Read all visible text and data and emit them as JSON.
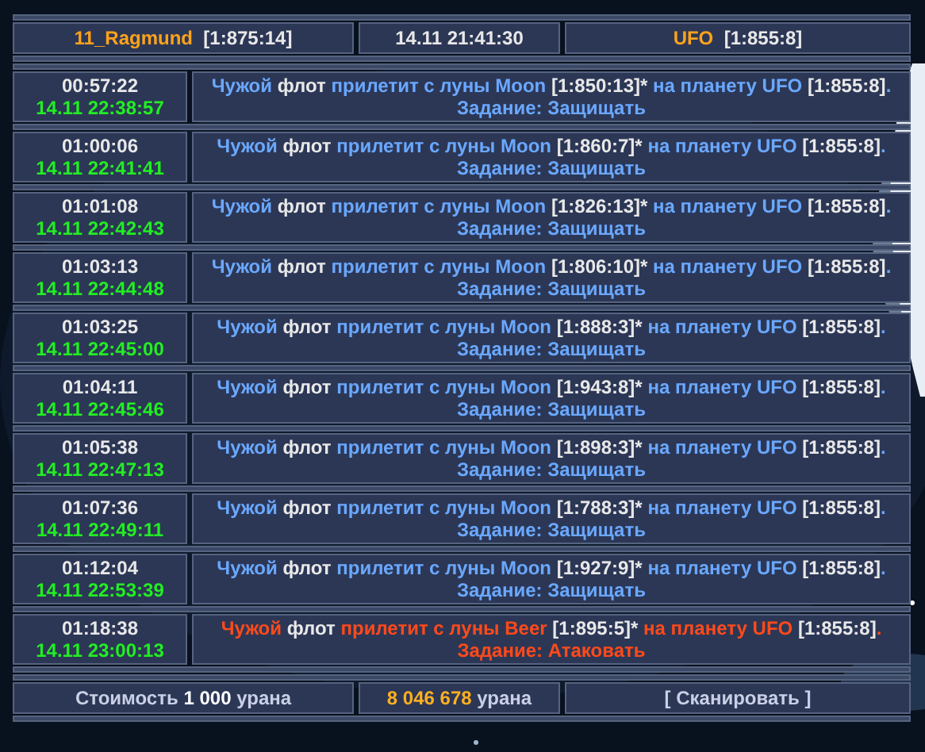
{
  "header": {
    "player": {
      "name": "11_Ragmund",
      "coords": "[1:875:14]"
    },
    "clock": "14.11 21:41:30",
    "planet": {
      "name": "UFO",
      "coords": "[1:855:8]"
    }
  },
  "events": [
    {
      "countdown": "00:57:22",
      "arrival": "14.11 22:38:57",
      "kind": "defend",
      "who": "Чужой",
      "fleet": "флот",
      "origin": "прилетит с луны Moon",
      "origin_coords": "[1:850:13]*",
      "target": "на планету UFO",
      "target_coords": "[1:855:8]",
      "end": ".",
      "mission": "Задание: Защищать"
    },
    {
      "countdown": "01:00:06",
      "arrival": "14.11 22:41:41",
      "kind": "defend",
      "who": "Чужой",
      "fleet": "флот",
      "origin": "прилетит с луны Moon",
      "origin_coords": "[1:860:7]*",
      "target": "на планету UFO",
      "target_coords": "[1:855:8]",
      "end": ".",
      "mission": "Задание: Защищать"
    },
    {
      "countdown": "01:01:08",
      "arrival": "14.11 22:42:43",
      "kind": "defend",
      "who": "Чужой",
      "fleet": "флот",
      "origin": "прилетит с луны Moon",
      "origin_coords": "[1:826:13]*",
      "target": "на планету UFO",
      "target_coords": "[1:855:8]",
      "end": ".",
      "mission": "Задание: Защищать"
    },
    {
      "countdown": "01:03:13",
      "arrival": "14.11 22:44:48",
      "kind": "defend",
      "who": "Чужой",
      "fleet": "флот",
      "origin": "прилетит с луны Moon",
      "origin_coords": "[1:806:10]*",
      "target": "на планету UFO",
      "target_coords": "[1:855:8]",
      "end": ".",
      "mission": "Задание: Защищать"
    },
    {
      "countdown": "01:03:25",
      "arrival": "14.11 22:45:00",
      "kind": "defend",
      "who": "Чужой",
      "fleet": "флот",
      "origin": "прилетит с луны Moon",
      "origin_coords": "[1:888:3]*",
      "target": "на планету UFO",
      "target_coords": "[1:855:8]",
      "end": ".",
      "mission": "Задание: Защищать"
    },
    {
      "countdown": "01:04:11",
      "arrival": "14.11 22:45:46",
      "kind": "defend",
      "who": "Чужой",
      "fleet": "флот",
      "origin": "прилетит с луны Moon",
      "origin_coords": "[1:943:8]*",
      "target": "на планету UFO",
      "target_coords": "[1:855:8]",
      "end": ".",
      "mission": "Задание: Защищать"
    },
    {
      "countdown": "01:05:38",
      "arrival": "14.11 22:47:13",
      "kind": "defend",
      "who": "Чужой",
      "fleet": "флот",
      "origin": "прилетит с луны Moon",
      "origin_coords": "[1:898:3]*",
      "target": "на планету UFO",
      "target_coords": "[1:855:8]",
      "end": ".",
      "mission": "Задание: Защищать"
    },
    {
      "countdown": "01:07:36",
      "arrival": "14.11 22:49:11",
      "kind": "defend",
      "who": "Чужой",
      "fleet": "флот",
      "origin": "прилетит с луны Moon",
      "origin_coords": "[1:788:3]*",
      "target": "на планету UFO",
      "target_coords": "[1:855:8]",
      "end": ".",
      "mission": "Задание: Защищать"
    },
    {
      "countdown": "01:12:04",
      "arrival": "14.11 22:53:39",
      "kind": "defend",
      "who": "Чужой",
      "fleet": "флот",
      "origin": "прилетит с луны Moon",
      "origin_coords": "[1:927:9]*",
      "target": "на планету UFO",
      "target_coords": "[1:855:8]",
      "end": ".",
      "mission": "Задание: Защищать"
    },
    {
      "countdown": "01:18:38",
      "arrival": "14.11 23:00:13",
      "kind": "attack",
      "who": "Чужой",
      "fleet": "флот",
      "origin": "прилетит с луны Beer",
      "origin_coords": "[1:895:5]*",
      "target": "на планету UFO",
      "target_coords": "[1:855:8]",
      "end": ".",
      "mission": "Задание: Атаковать"
    }
  ],
  "footer": {
    "cost": {
      "label": "Стоимость",
      "amount": "1 000",
      "unit": "урана"
    },
    "balance": {
      "amount": "8 046 678",
      "unit": "урана"
    },
    "scan_button": "[ Сканировать ]"
  }
}
